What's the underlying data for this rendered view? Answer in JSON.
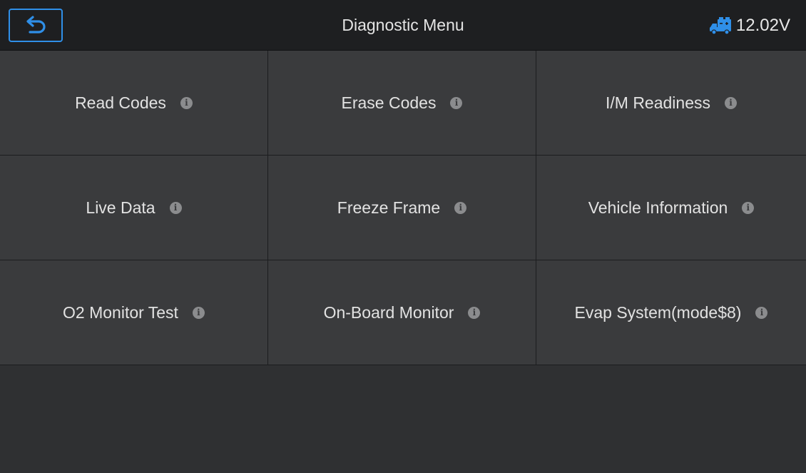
{
  "header": {
    "title": "Diagnostic Menu",
    "back_icon": "back-arrow-icon",
    "battery_icon": "vehicle-battery-icon",
    "voltage": "12.02V",
    "accent_color": "#2f8fe8"
  },
  "menu": {
    "items": [
      {
        "label": "Read Codes",
        "icon": "info-icon"
      },
      {
        "label": "Erase Codes",
        "icon": "info-icon"
      },
      {
        "label": "I/M Readiness",
        "icon": "info-icon"
      },
      {
        "label": "Live Data",
        "icon": "info-icon"
      },
      {
        "label": "Freeze Frame",
        "icon": "info-icon"
      },
      {
        "label": "Vehicle Information",
        "icon": "info-icon"
      },
      {
        "label": "O2 Monitor Test",
        "icon": "info-icon"
      },
      {
        "label": "On-Board Monitor",
        "icon": "info-icon"
      },
      {
        "label": "Evap System(mode$8)",
        "icon": "info-icon"
      }
    ]
  }
}
